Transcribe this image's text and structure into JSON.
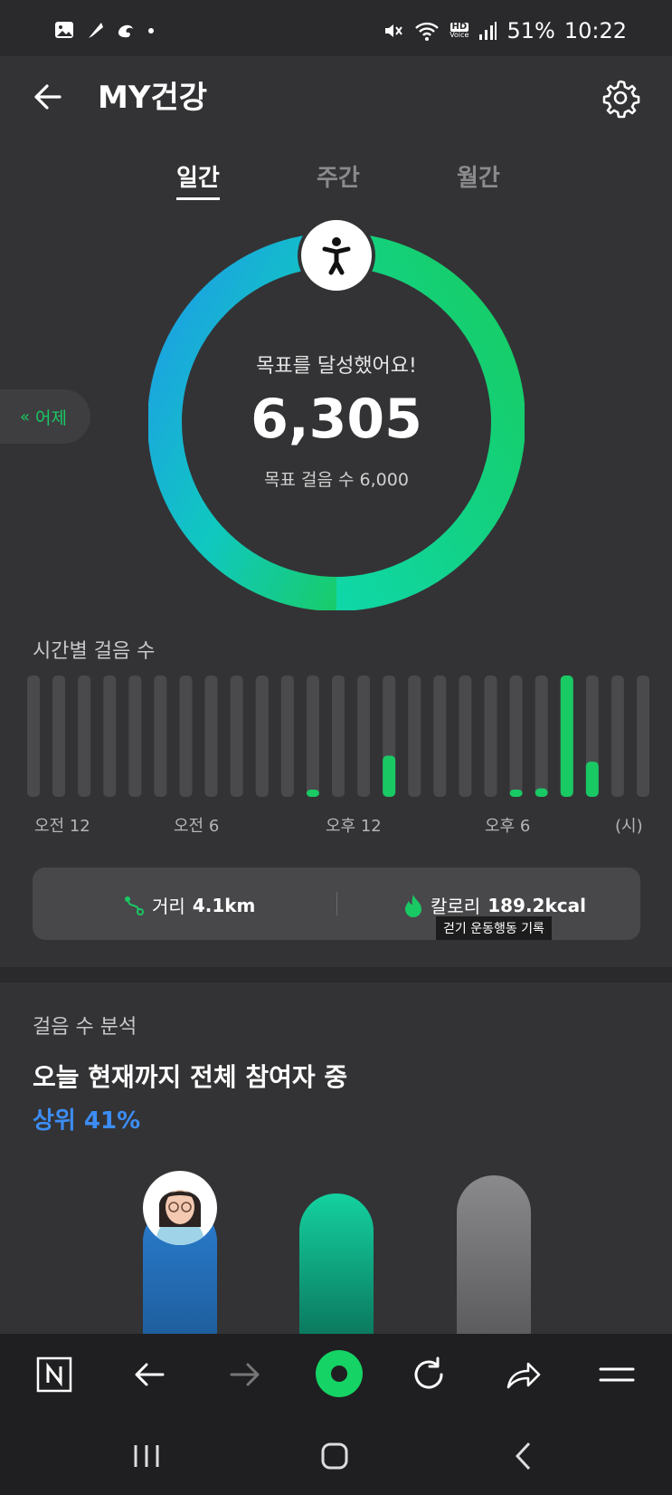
{
  "status_bar": {
    "battery": "51%",
    "time": "10:22",
    "hd_label": "HD",
    "voice_label": "Voice",
    "left_icons": [
      "gallery-icon",
      "feather-icon",
      "swirl-icon",
      "dot-icon"
    ],
    "right_icons": [
      "mute-icon",
      "wifi-icon",
      "hd-voice-icon",
      "signal-icon"
    ]
  },
  "header": {
    "title": "MY건강"
  },
  "tabs": [
    {
      "label": "일간",
      "active": true
    },
    {
      "label": "주간",
      "active": false
    },
    {
      "label": "월간",
      "active": false
    }
  ],
  "ring": {
    "message": "목표를 달성했어요!",
    "steps": "6,305",
    "goal_text": "목표 걸음 수 6,000",
    "progress": 1.0,
    "colors": {
      "start": "#1e9be8",
      "end": "#18cc6e"
    }
  },
  "yesterday": {
    "label": "어제"
  },
  "hourly": {
    "label": "시간별 걸음 수",
    "x_labels": [
      "오전 12",
      "오전 6",
      "오후 12",
      "오후 6",
      "(시)"
    ],
    "values": [
      0,
      0,
      0,
      0,
      0,
      0,
      0,
      0,
      0,
      0,
      0,
      0.01,
      0,
      0,
      0.34,
      0,
      0,
      0,
      0,
      0.06,
      0.07,
      1.0,
      0.29,
      0,
      0
    ],
    "bar_color": "#19c964",
    "track_color": "#4a4a4d"
  },
  "stats": {
    "distance_label": "거리",
    "distance_value": "4.1km",
    "calorie_label": "칼로리",
    "calorie_value": "189.2kcal",
    "tooltip": "걷기 운동행동 기록"
  },
  "analysis": {
    "label": "걸음 수 분석",
    "headline": "오늘 현재까지 전체 참여자 중",
    "rank": "상위 41%"
  },
  "browser_toolbar": [
    "naver-icon",
    "back-arrow-icon",
    "forward-arrow-icon",
    "home-ring-icon",
    "refresh-icon",
    "share-icon",
    "menu-icon"
  ],
  "nav_bar": [
    "recent-apps-icon",
    "home-icon",
    "back-icon"
  ]
}
